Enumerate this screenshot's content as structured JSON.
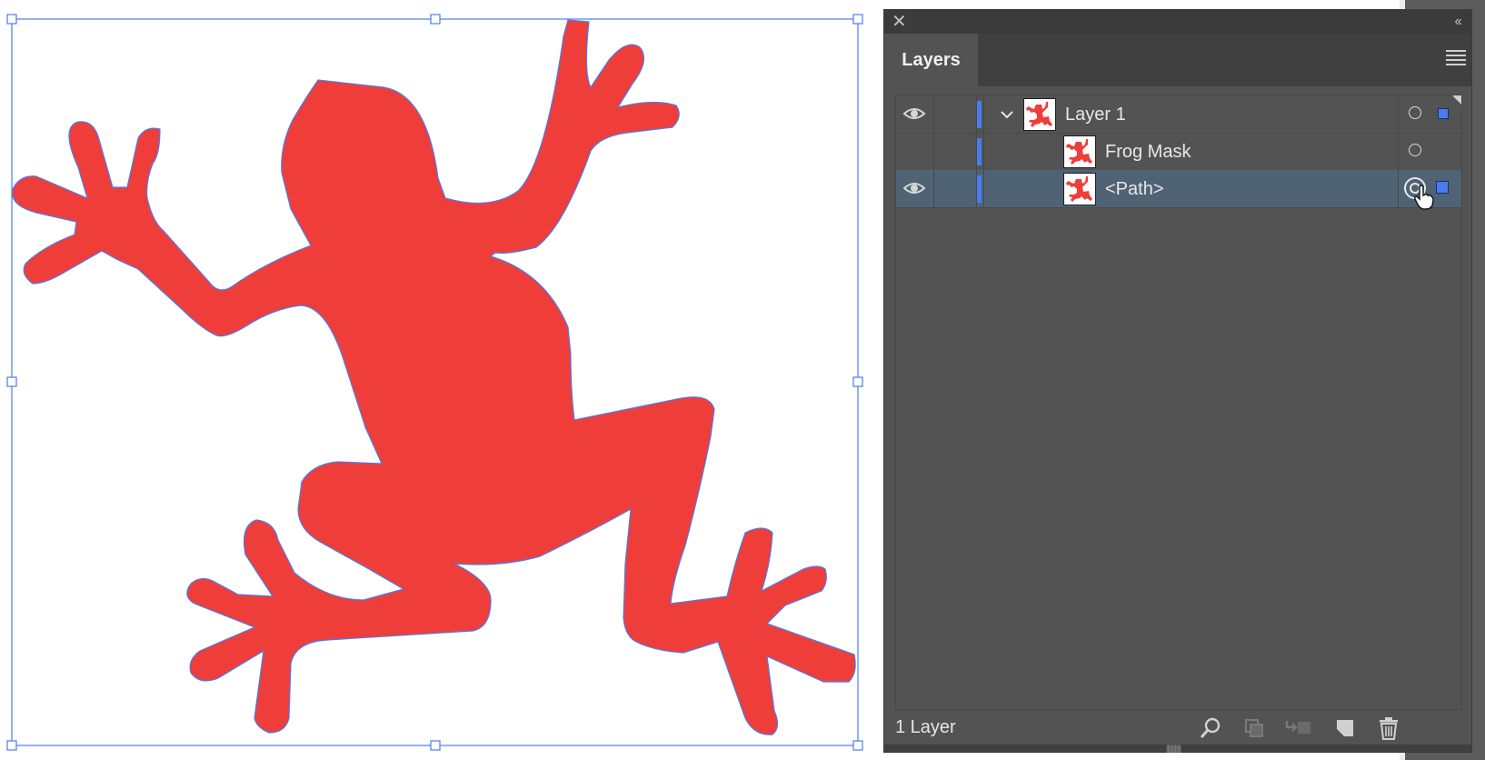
{
  "panel": {
    "close_glyph": "✕",
    "collapse_glyph": "‹‹",
    "tab_label": "Layers",
    "menu_icon": "hamburger-menu-icon"
  },
  "layers": [
    {
      "name": "Layer 1",
      "visible": true,
      "expanded": true,
      "selected": false,
      "color": "#4c7bf0"
    },
    {
      "name": "Frog Mask",
      "visible": false,
      "expanded": false,
      "selected": false,
      "color": "#4c7bf0"
    },
    {
      "name": "<Path>",
      "visible": true,
      "expanded": false,
      "selected": true,
      "color": "#4c7bf0"
    }
  ],
  "footer": {
    "layer_count": "1 Layer",
    "tools": [
      "search-icon",
      "make-clipping-mask-icon",
      "new-sublayer-icon",
      "new-layer-icon",
      "delete-icon"
    ]
  },
  "canvas": {
    "object_fill": "#ef3e3a",
    "selection_color": "#4c7bf0"
  }
}
